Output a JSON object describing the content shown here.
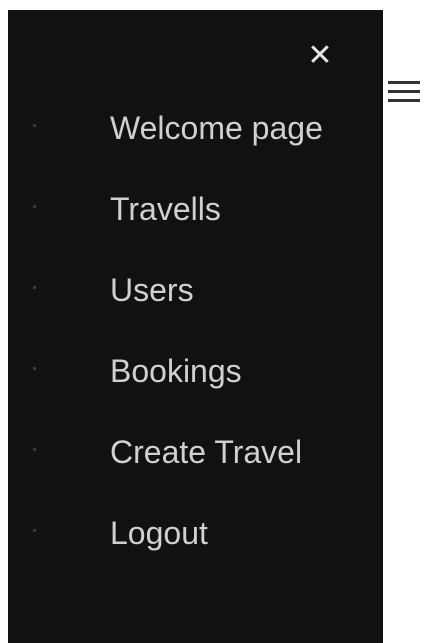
{
  "sidebar": {
    "close_glyph": "✕",
    "items": [
      {
        "label": "Welcome page"
      },
      {
        "label": "Travells"
      },
      {
        "label": "Users"
      },
      {
        "label": "Bookings"
      },
      {
        "label": "Create Travel"
      },
      {
        "label": "Logout"
      }
    ]
  },
  "icons": {
    "close": "close-icon",
    "menu": "hamburger-menu-icon"
  },
  "colors": {
    "sidebar_background": "#111111",
    "sidebar_text": "#d0d0d0",
    "page_background": "#ffffff"
  }
}
